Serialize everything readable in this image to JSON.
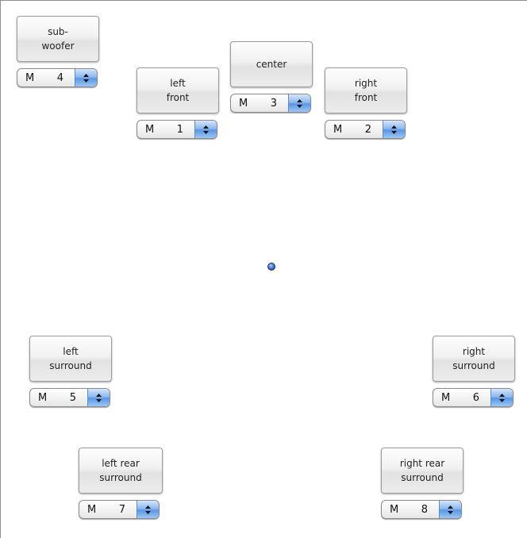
{
  "speakers": {
    "subwoofer": {
      "label": "sub-\nwoofer",
      "channel_mode": "M",
      "channel_number": "4"
    },
    "left_front": {
      "label": "left\nfront",
      "channel_mode": "M",
      "channel_number": "1"
    },
    "center": {
      "label": "center",
      "channel_mode": "M",
      "channel_number": "3"
    },
    "right_front": {
      "label": "right\nfront",
      "channel_mode": "M",
      "channel_number": "2"
    },
    "left_surround": {
      "label": "left\nsurround",
      "channel_mode": "M",
      "channel_number": "5"
    },
    "right_surround": {
      "label": "right\nsurround",
      "channel_mode": "M",
      "channel_number": "6"
    },
    "left_rear_surround": {
      "label": "left rear\nsurround",
      "channel_mode": "M",
      "channel_number": "7"
    },
    "right_rear_surround": {
      "label": "right rear\nsurround",
      "channel_mode": "M",
      "channel_number": "8"
    }
  },
  "icons": {
    "popup_arrows": "up-down-stepper-icon",
    "pan_position": "pan-position-dot"
  },
  "colors": {
    "accent": "#5a97e4",
    "dot": "#2f5fb8"
  }
}
